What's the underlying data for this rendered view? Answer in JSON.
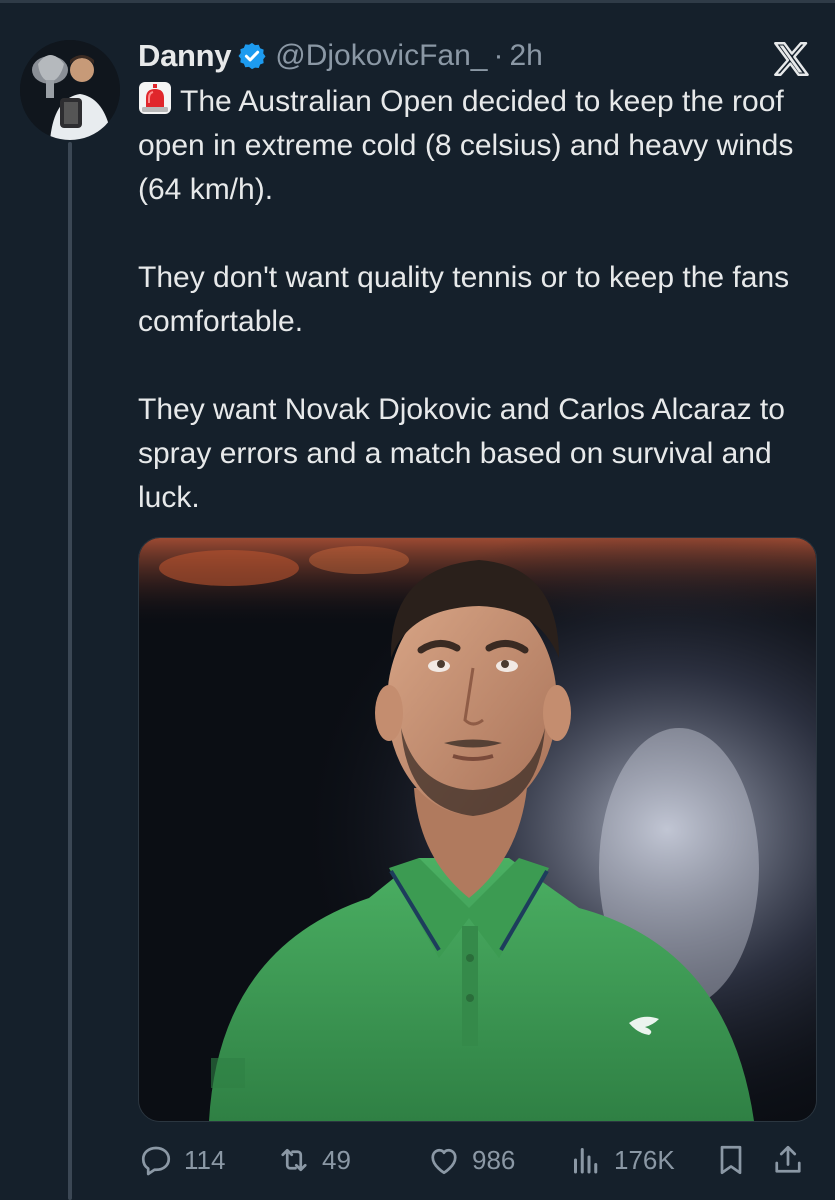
{
  "author": {
    "display_name": "Danny",
    "handle": "@DjokovicFan_",
    "separator": "·",
    "timestamp": "2h",
    "verified": true
  },
  "tweet": {
    "paragraphs": [
      "The Australian Open decided to keep the roof open in extreme cold (8 celsius) and heavy winds (64 km/h).",
      "They don't want quality tennis or to keep the fans comfortable.",
      "They want Novak Djokovic and Carlos Alcaraz to spray errors and a match based on survival and luck."
    ],
    "leading_emoji": "rotating-light-emoji"
  },
  "media": {
    "type": "photo",
    "description_icon": "player-photo"
  },
  "actions": {
    "replies": "114",
    "retweets": "49",
    "likes": "986",
    "views": "176K"
  },
  "colors": {
    "background": "#15202b",
    "primary_text": "#e7e9ea",
    "secondary_text": "#8b98a5",
    "verified_badge": "#1d9bf0",
    "shirt_green": "#3f9c55"
  }
}
